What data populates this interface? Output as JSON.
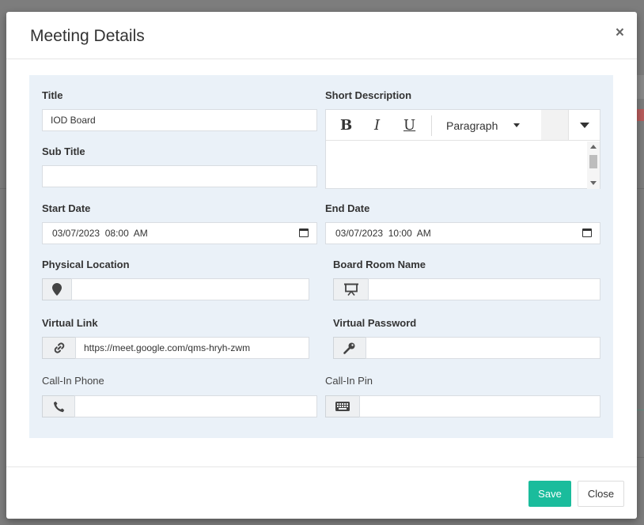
{
  "modal": {
    "title": "Meeting Details",
    "close_glyph": "×"
  },
  "form": {
    "title": {
      "label": "Title",
      "value": "IOD Board"
    },
    "sub_title": {
      "label": "Sub Title",
      "value": ""
    },
    "short_description": {
      "label": "Short Description",
      "toolbar": {
        "bold": "B",
        "italic": "I",
        "underline": "U",
        "paragraph": "Paragraph"
      },
      "value": ""
    },
    "start_date": {
      "label": "Start Date",
      "value": "03/07/2023  08:00  AM"
    },
    "end_date": {
      "label": "End Date",
      "value": "03/07/2023  10:00  AM"
    },
    "physical_location": {
      "label": "Physical Location",
      "icon": "map-marker-icon",
      "value": ""
    },
    "board_room_name": {
      "label": "Board Room Name",
      "icon": "presentation-board-icon",
      "value": ""
    },
    "virtual_link": {
      "label": "Virtual Link",
      "icon": "link-icon",
      "value": "https://meet.google.com/qms-hryh-zwm"
    },
    "virtual_password": {
      "label": "Virtual Password",
      "icon": "key-icon",
      "value": ""
    },
    "call_in_phone": {
      "label": "Call-In Phone",
      "icon": "phone-icon",
      "value": ""
    },
    "call_in_pin": {
      "label": "Call-In Pin",
      "icon": "keyboard-icon",
      "value": ""
    }
  },
  "footer": {
    "save_label": "Save",
    "close_label": "Close"
  },
  "colors": {
    "save_button": "#1abc9c",
    "panel_background": "#eaf1f8"
  }
}
